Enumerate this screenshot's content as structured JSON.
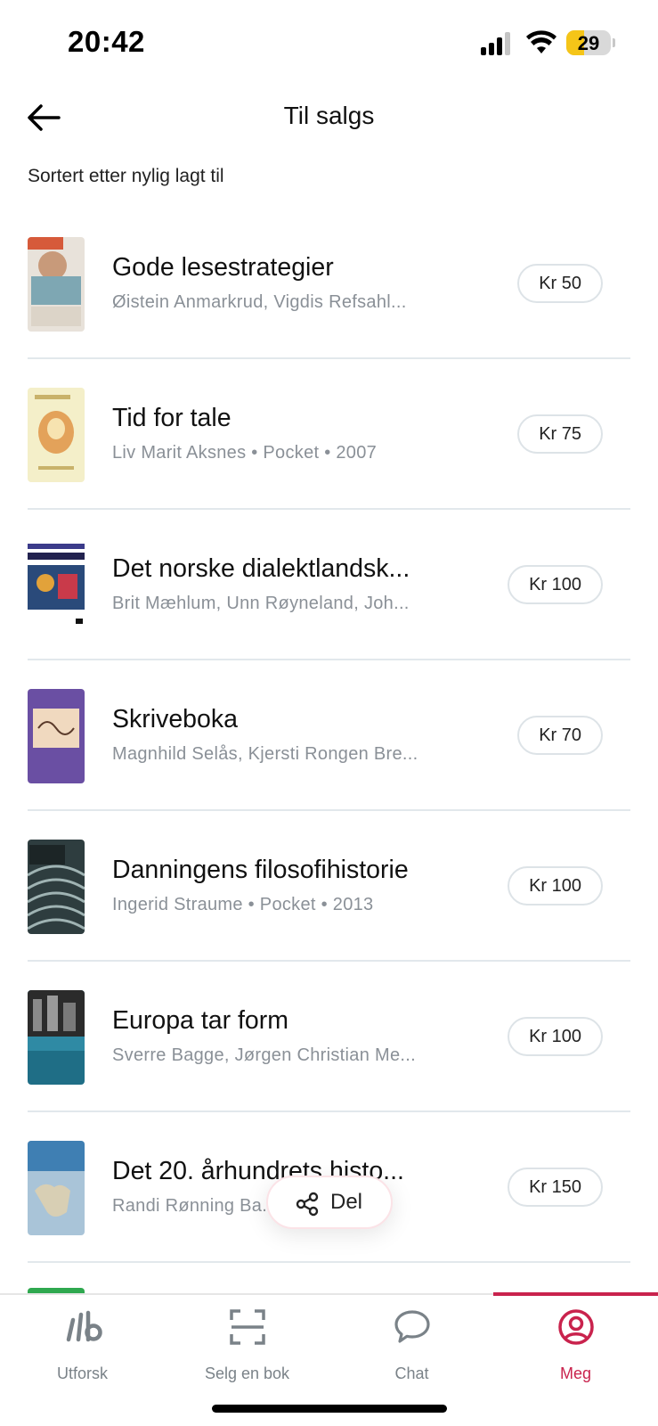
{
  "status_bar": {
    "time": "20:42",
    "battery": "29"
  },
  "header": {
    "title": "Til salgs"
  },
  "sort_label": "Sortert etter nylig lagt til",
  "books": [
    {
      "title": "Gode lesestrategier",
      "subtitle": "Øistein Anmarkrud, Vigdis Refsahl...",
      "price": "Kr 50"
    },
    {
      "title": "Tid for tale",
      "subtitle": "Liv Marit Aksnes • Pocket • 2007",
      "price": "Kr 75"
    },
    {
      "title": "Det norske dialektlandsk...",
      "subtitle": "Brit Mæhlum, Unn Røyneland, Joh...",
      "price": "Kr 100"
    },
    {
      "title": "Skriveboka",
      "subtitle": "Magnhild Selås, Kjersti Rongen Bre...",
      "price": "Kr 70"
    },
    {
      "title": "Danningens filosofihistorie",
      "subtitle": "Ingerid Straume • Pocket • 2013",
      "price": "Kr 100"
    },
    {
      "title": "Europa tar form",
      "subtitle": "Sverre Bagge, Jørgen Christian Me...",
      "price": "Kr 100"
    },
    {
      "title": "Det 20. århundrets histo...",
      "subtitle": "Randi Rønning Ba...",
      "price": "Kr 150"
    }
  ],
  "share": {
    "label": "Del"
  },
  "tabs": [
    {
      "label": "Utforsk"
    },
    {
      "label": "Selg en bok"
    },
    {
      "label": "Chat"
    },
    {
      "label": "Meg"
    }
  ],
  "colors": {
    "accent": "#c9234d",
    "muted_text": "#8a9097",
    "divider": "#e2e8ec"
  }
}
